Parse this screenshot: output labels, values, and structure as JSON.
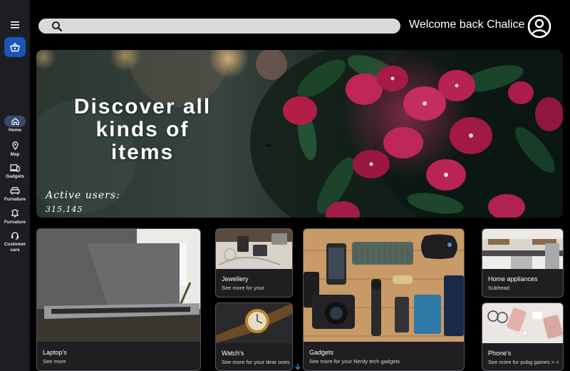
{
  "sidebar": {
    "items": [
      {
        "label": "Home",
        "icon": "home-icon"
      },
      {
        "label": "Map",
        "icon": "map-pin-icon"
      },
      {
        "label": "Gadgets",
        "icon": "devices-icon"
      },
      {
        "label": "Furnature",
        "icon": "sofa-icon"
      },
      {
        "label": "Furnature",
        "icon": "bell-icon"
      },
      {
        "label": "Customer care",
        "icon": "headset-icon"
      }
    ]
  },
  "header": {
    "search_placeholder": "",
    "welcome": "Welcome back Chalice"
  },
  "hero": {
    "title": "Discover all kinds of items",
    "users_label": "Active users:",
    "users_value": "315,145"
  },
  "cards": {
    "laptops": {
      "title": "Laptop's",
      "subtitle": "See more"
    },
    "jewellery": {
      "title": "Jewellery",
      "subtitle": "See more for your"
    },
    "watches": {
      "title": "Watch's",
      "subtitle": "See more for your dear ones"
    },
    "gadgets": {
      "title": "Gadgets",
      "subtitle": "See more for your Nerdy tech gadgets"
    },
    "home_appliances": {
      "title": "Home appliances",
      "subtitle": "Subhead"
    },
    "phones": {
      "title": "Phone's",
      "subtitle": "See more for pubg games >.<"
    }
  },
  "colors": {
    "background": "#000000",
    "sidebar": "#1e1e22",
    "accent": "#1a56b8",
    "card": "#1f1f22"
  }
}
